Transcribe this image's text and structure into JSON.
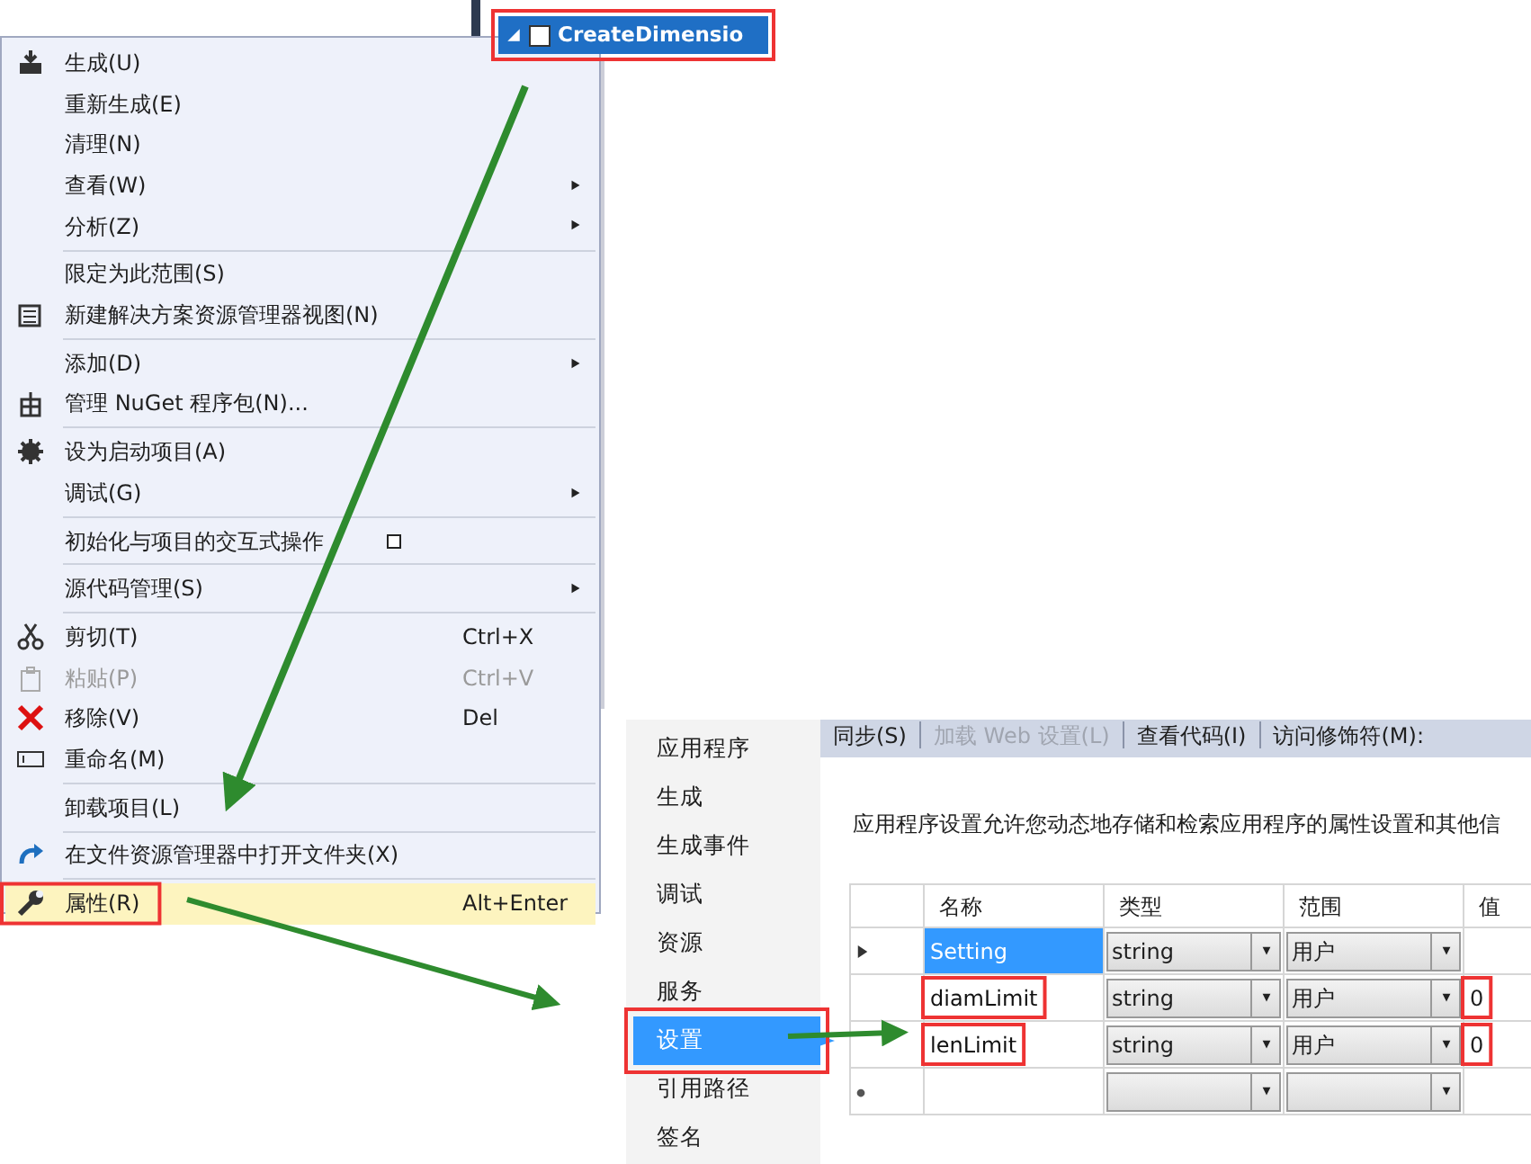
{
  "solution_explorer": {
    "selected_item": {
      "label": "CreateDimensio",
      "selected": true
    }
  },
  "context_menu": {
    "items": [
      {
        "label": "生成(U)",
        "separator_before": false,
        "submenu": false,
        "disabled": false,
        "selected": false
      },
      {
        "label": "重新生成(E)",
        "separator_before": false,
        "submenu": false,
        "disabled": false,
        "selected": false
      },
      {
        "label": "清理(N)",
        "separator_before": false,
        "submenu": false,
        "disabled": false,
        "selected": false
      },
      {
        "label": "查看(W)",
        "separator_before": false,
        "submenu": true,
        "disabled": false,
        "selected": false
      },
      {
        "label": "分析(Z)",
        "separator_before": false,
        "submenu": true,
        "disabled": false,
        "selected": false
      },
      {
        "label": "限定为此范围(S)",
        "separator_before": true,
        "submenu": false,
        "disabled": false,
        "selected": false
      },
      {
        "label": "新建解决方案资源管理器视图(N)",
        "separator_before": false,
        "submenu": false,
        "disabled": false,
        "selected": false
      },
      {
        "label": "添加(D)",
        "separator_before": true,
        "submenu": true,
        "disabled": false,
        "selected": false
      },
      {
        "label": "管理 NuGet 程序包(N)...",
        "separator_before": false,
        "submenu": false,
        "disabled": false,
        "selected": false
      },
      {
        "label": "设为启动项目(A)",
        "separator_before": true,
        "submenu": false,
        "disabled": false,
        "selected": false
      },
      {
        "label": "调试(G)",
        "separator_before": false,
        "submenu": true,
        "disabled": false,
        "selected": false
      },
      {
        "label": "初始化与项目的交互式操作",
        "separator_before": true,
        "submenu": false,
        "disabled": false,
        "selected": false,
        "kind": "checkbox",
        "checked": false
      },
      {
        "label": "源代码管理(S)",
        "separator_before": true,
        "submenu": true,
        "disabled": false,
        "selected": false
      },
      {
        "label": "剪切(T)",
        "shortcut": "Ctrl+X",
        "separator_before": true,
        "submenu": false,
        "disabled": false,
        "selected": false
      },
      {
        "label": "粘贴(P)",
        "shortcut": "Ctrl+V",
        "separator_before": false,
        "submenu": false,
        "disabled": true,
        "selected": false
      },
      {
        "label": "移除(V)",
        "shortcut": "Del",
        "separator_before": false,
        "submenu": false,
        "disabled": false,
        "selected": false
      },
      {
        "label": "重命名(M)",
        "separator_before": false,
        "submenu": false,
        "disabled": false,
        "selected": false
      },
      {
        "label": "卸载项目(L)",
        "separator_before": true,
        "submenu": false,
        "disabled": false,
        "selected": false
      },
      {
        "label": "在文件资源管理器中打开文件夹(X)",
        "separator_before": true,
        "submenu": false,
        "disabled": false,
        "selected": false
      },
      {
        "label": "属性(R)",
        "shortcut": "Alt+Enter",
        "separator_before": true,
        "submenu": false,
        "disabled": false,
        "selected": true
      }
    ]
  },
  "properties": {
    "sidebar": {
      "items": [
        {
          "label": "应用程序",
          "selected": false
        },
        {
          "label": "生成",
          "selected": false
        },
        {
          "label": "生成事件",
          "selected": false
        },
        {
          "label": "调试",
          "selected": false
        },
        {
          "label": "资源",
          "selected": false
        },
        {
          "label": "服务",
          "selected": false
        },
        {
          "label": "设置",
          "selected": true
        },
        {
          "label": "引用路径",
          "selected": false
        },
        {
          "label": "签名",
          "selected": false
        }
      ]
    },
    "toolbar": [
      {
        "label": "同步(S)",
        "disabled": false
      },
      {
        "label": "加载 Web 设置(L)",
        "disabled": true
      },
      {
        "label": "查看代码(I)",
        "disabled": false
      },
      {
        "label": "访问修饰符(M):",
        "disabled": false
      }
    ],
    "description": "应用程序设置允许您动态地存储和检索应用程序的属性设置和其他信",
    "table": {
      "columns": [
        "名称",
        "类型",
        "范围",
        "值"
      ],
      "rows": [
        {
          "kind": "data",
          "selected": true,
          "name": "Setting",
          "type": "string",
          "scope": "用户"
        },
        {
          "kind": "data",
          "selected": false,
          "name": "diamLimit",
          "type": "string",
          "scope": "用户",
          "value": "0"
        },
        {
          "kind": "data",
          "selected": false,
          "name": "lenLimit",
          "type": "string",
          "scope": "用户",
          "value": "0"
        },
        {
          "kind": "new",
          "selected": false
        }
      ]
    }
  }
}
